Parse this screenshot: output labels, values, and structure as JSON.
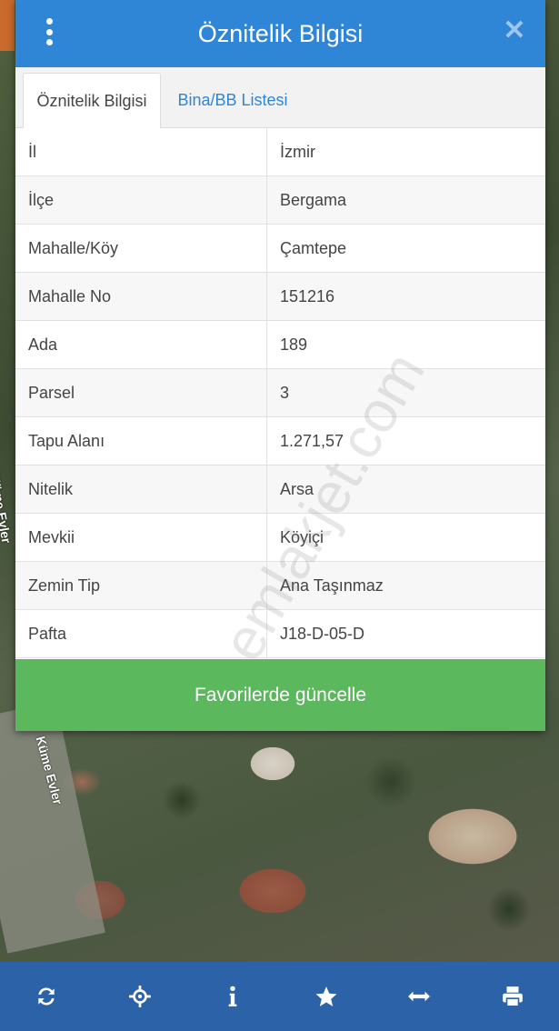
{
  "dialog": {
    "title": "Öznitelik Bilgisi",
    "tabs": [
      {
        "label": "Öznitelik Bilgisi",
        "active": true
      },
      {
        "label": "Bina/BB Listesi",
        "active": false
      }
    ],
    "rows": [
      {
        "key": "İl",
        "value": "İzmir"
      },
      {
        "key": "İlçe",
        "value": "Bergama"
      },
      {
        "key": "Mahalle/Köy",
        "value": "Çamtepe"
      },
      {
        "key": "Mahalle No",
        "value": "151216"
      },
      {
        "key": "Ada",
        "value": "189"
      },
      {
        "key": "Parsel",
        "value": "3"
      },
      {
        "key": "Tapu Alanı",
        "value": "1.271,57"
      },
      {
        "key": "Nitelik",
        "value": "Arsa"
      },
      {
        "key": "Mevkii",
        "value": "Köyiçi"
      },
      {
        "key": "Zemin Tip",
        "value": "Ana Taşınmaz"
      },
      {
        "key": "Pafta",
        "value": "J18-D-05-D"
      }
    ],
    "favorite_button": "Favorilerde güncelle",
    "watermark": "emlakjet.com"
  },
  "map": {
    "labels": [
      "Küme Evler",
      "Küme Evler"
    ]
  },
  "toolbar": {
    "icons": [
      "refresh-icon",
      "locate-icon",
      "info-icon",
      "star-icon",
      "measure-icon",
      "print-icon"
    ]
  },
  "colors": {
    "header": "#2f86d6",
    "button": "#5cb85c",
    "toolbar": "#2c62a8",
    "tab_link": "#2f86d6"
  }
}
